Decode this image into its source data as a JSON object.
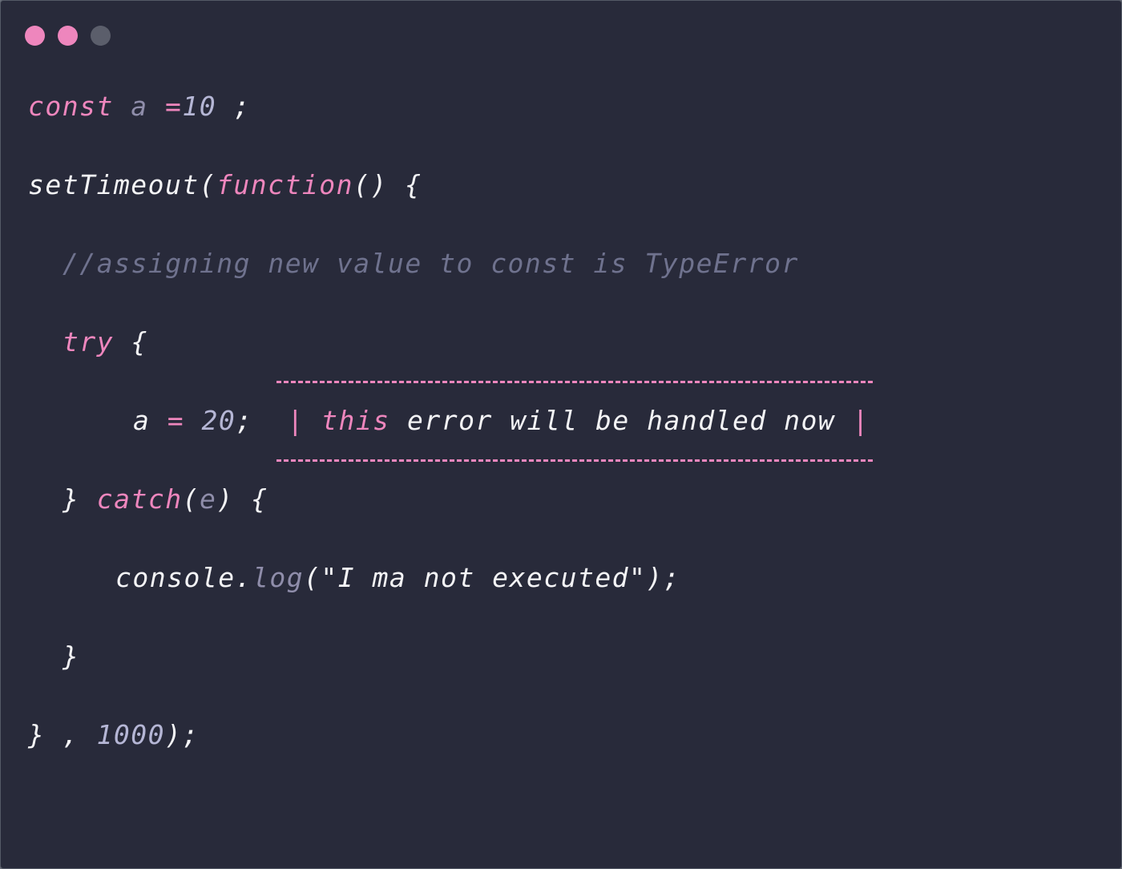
{
  "colors": {
    "background": "#282a3a",
    "keyword": "#ee86bd",
    "variable": "#8f8daa",
    "number": "#b5b6d5",
    "comment": "#6f728e",
    "text": "#f4f4f6",
    "dot_1": "#ee86bd",
    "dot_2": "#ee86bd",
    "dot_3": "#5b5e6b"
  },
  "window_controls": [
    "close-dot",
    "minimize-dot",
    "maximize-dot"
  ],
  "code": {
    "line_1": {
      "kw_const": "const",
      "var_a": "a",
      "eq": "=",
      "num": "10",
      "end": " ;"
    },
    "line_2": {
      "fn_name": "setTimeout(",
      "kw_function": "function",
      "rest": "() {"
    },
    "line_3": {
      "comment": "//assigning new value to const is TypeError"
    },
    "line_4": {
      "kw_try": "try",
      "rest": " {"
    },
    "line_5": {
      "var_a": "a",
      "eq": "=",
      "num": "20",
      "end": ";",
      "pipe_open": "|",
      "kw_this": "this",
      "note": "error will be handled now",
      "pipe_close": "|"
    },
    "line_6": {
      "close": "}",
      "kw_catch": "catch",
      "open_paren": "(",
      "var_e": "e",
      "rest": ") {"
    },
    "line_7": {
      "obj": "console.",
      "method": "log",
      "rest": "(\"I ma not executed\");"
    },
    "line_8": {
      "close": "}"
    },
    "line_9": {
      "close": "}",
      "comma": ",",
      "num": "1000",
      "rest": ");"
    }
  }
}
